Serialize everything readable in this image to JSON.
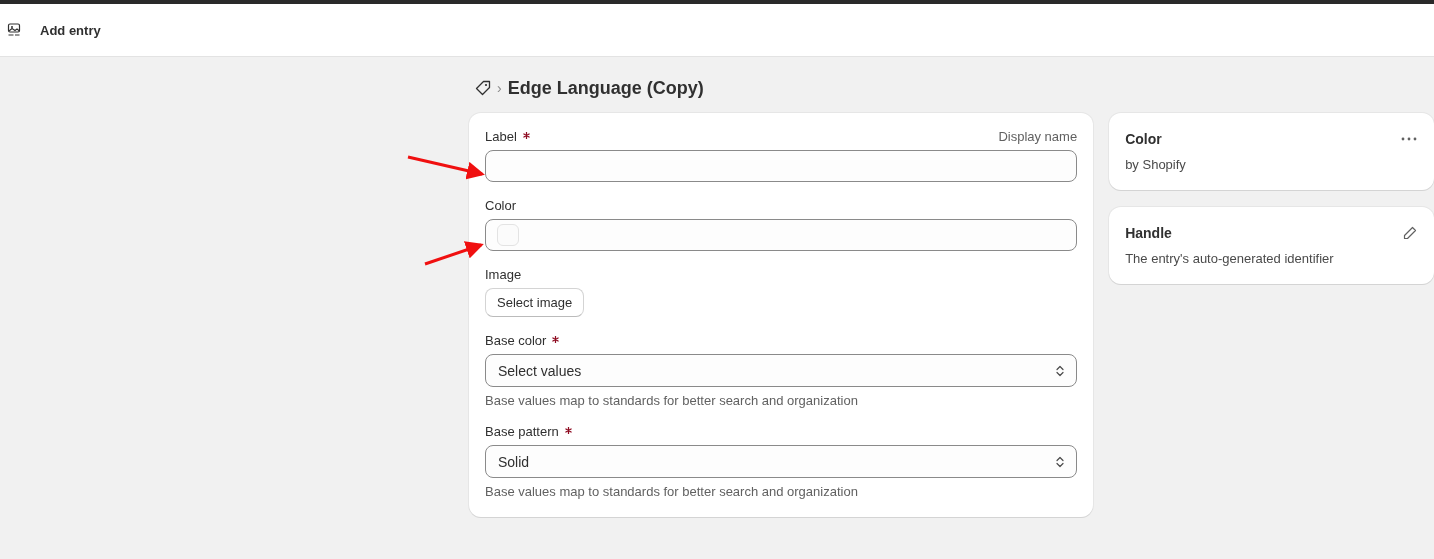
{
  "header": {
    "title": "Add entry"
  },
  "breadcrumb": {
    "separator": "›",
    "title": "Edge Language (Copy)"
  },
  "fields": [
    {
      "kind": "text",
      "label": "Label",
      "required": true,
      "aside": "Display name"
    },
    {
      "kind": "color",
      "label": "Color",
      "required": false
    },
    {
      "kind": "image",
      "label": "Image",
      "required": false,
      "button": "Select image"
    },
    {
      "kind": "select",
      "label": "Base color",
      "required": true,
      "placeholder": "Select values",
      "help": "Base values map to standards for better search and organization"
    },
    {
      "kind": "select",
      "label": "Base pattern",
      "required": true,
      "value": "Solid",
      "help": "Base values map to standards for better search and organization"
    }
  ],
  "side_cards": [
    {
      "kind": "menu",
      "title": "Color",
      "subtitle": "by Shopify"
    },
    {
      "kind": "edit",
      "title": "Handle",
      "subtitle": "The entry's auto-generated identifier"
    }
  ]
}
